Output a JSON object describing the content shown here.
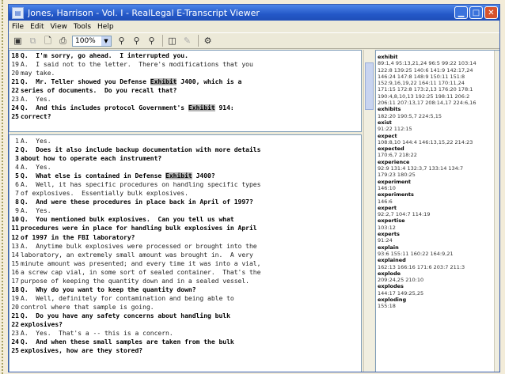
{
  "window": {
    "title": "Jones, Harrison - Vol. I - RealLegal E-Transcript Viewer"
  },
  "menu": [
    "File",
    "Edit",
    "View",
    "Tools",
    "Help"
  ],
  "toolbar": {
    "zoom": "100%"
  },
  "pane1": [
    {
      "n": "18",
      "t": "Q.  I'm sorry, go ahead.  I interrupted you.",
      "q": true
    },
    {
      "n": "19",
      "t": "A.  I said not to the letter.  There's modifications that you",
      "q": false
    },
    {
      "n": "20",
      "t": "may take.",
      "q": false
    },
    {
      "n": "21",
      "t": "Q.  Mr. Teller showed you Defense [Exhibit] J400, which is a",
      "q": true
    },
    {
      "n": "22",
      "t": "series of documents.  Do you recall that?",
      "q": true
    },
    {
      "n": "23",
      "t": "A.  Yes.",
      "q": false
    },
    {
      "n": "24",
      "t": "Q.  And this includes protocol Government's [Exhibit] 914:",
      "q": true
    },
    {
      "n": "25",
      "t": "correct?",
      "q": true
    }
  ],
  "pane2": [
    {
      "n": "1",
      "t": "A.  Yes.",
      "q": false
    },
    {
      "n": "2",
      "t": "Q.  Does it also include backup documentation with more details",
      "q": true
    },
    {
      "n": "3",
      "t": "about how to operate each instrument?",
      "q": true
    },
    {
      "n": "4",
      "t": "A.  Yes.",
      "q": false
    },
    {
      "n": "5",
      "t": "Q.  What else is contained in Defense [Exhibit] J400?",
      "q": true
    },
    {
      "n": "6",
      "t": "A.  Well, it has specific procedures on handling specific types",
      "q": false
    },
    {
      "n": "7",
      "t": "of explosives.  Essentially bulk explosives.",
      "q": false
    },
    {
      "n": "8",
      "t": "Q.  And were these procedures in place back in April of 1997?",
      "q": true
    },
    {
      "n": "9",
      "t": "A.  Yes.",
      "q": false
    },
    {
      "n": "10",
      "t": "Q.  You mentioned bulk explosives.  Can you tell us what",
      "q": true
    },
    {
      "n": "11",
      "t": "procedures were in place for handling bulk explosives in April",
      "q": true
    },
    {
      "n": "12",
      "t": "of 1997 in the FBI laboratory?",
      "q": true
    },
    {
      "n": "13",
      "t": "A.  Anytime bulk explosives were processed or brought into the",
      "q": false
    },
    {
      "n": "14",
      "t": "laboratory, an extremely small amount was brought in.  A very",
      "q": false
    },
    {
      "n": "15",
      "t": "minute amount was presented; and every time it was into a vial,",
      "q": false
    },
    {
      "n": "16",
      "t": "a screw cap vial, in some sort of sealed container.  That's the",
      "q": false
    },
    {
      "n": "17",
      "t": "purpose of keeping the quantity down and in a sealed vessel.",
      "q": false
    },
    {
      "n": "18",
      "t": "Q.  Why do you want to keep the quantity down?",
      "q": true
    },
    {
      "n": "19",
      "t": "A.  Well, definitely for contamination and being able to",
      "q": false
    },
    {
      "n": "20",
      "t": "control where that sample is going.",
      "q": false
    },
    {
      "n": "21",
      "t": "Q.  Do you have any safety concerns about handling bulk",
      "q": true
    },
    {
      "n": "22",
      "t": "explosives?",
      "q": true
    },
    {
      "n": "23",
      "t": "A.  Yes.  That's a -- this is a concern.",
      "q": false
    },
    {
      "n": "24",
      "t": "Q.  And when these small samples are taken from the bulk",
      "q": true
    },
    {
      "n": "25",
      "t": "explosives, how are they stored?",
      "q": true
    }
  ],
  "index": [
    {
      "w": "exhibit",
      "p": [
        "89:1,4 95:13,21,24 96:5 99:22 103:14",
        "122:8 139:25 140:6 141:9 142:17,24",
        "146:24 147:8 148:9 150:11 151:8",
        "152:9,16,19,22 164:11 170:11,24",
        "171:15 172:8 173:2,13 176:20 178:1",
        "190:4,8,10,13 192:25 198:11 206:2",
        "206:11 207:13,17 208:14,17 224:6,16"
      ]
    },
    {
      "w": "exhibits",
      "p": [
        "182:20 190:5,7 224:5,15"
      ]
    },
    {
      "w": "exist",
      "p": [
        "91:22 112:15"
      ]
    },
    {
      "w": "expect",
      "p": [
        "108:8,10 144:4 146:13,15,22 214:23"
      ]
    },
    {
      "w": "expected",
      "p": [
        "170:6,7 218:22"
      ]
    },
    {
      "w": "experience",
      "p": [
        "92:9 131:4 132:3,7 133:14 134:7",
        "179:23 180:25"
      ]
    },
    {
      "w": "experiment",
      "p": [
        "146:10"
      ]
    },
    {
      "w": "experiments",
      "p": [
        "146:6"
      ]
    },
    {
      "w": "expert",
      "p": [
        "92:2,7 104:7 114:19"
      ]
    },
    {
      "w": "expertise",
      "p": [
        "103:12"
      ]
    },
    {
      "w": "experts",
      "p": [
        "91:24"
      ]
    },
    {
      "w": "explain",
      "p": [
        "93:6 155:11 160:22 164:9,21"
      ]
    },
    {
      "w": "explained",
      "p": [
        "162:13 166:16 171:6 203:7 211:3"
      ]
    },
    {
      "w": "explode",
      "p": [
        "209:24,25 210:10"
      ]
    },
    {
      "w": "explodes",
      "p": [
        "144:17 149:25,25"
      ]
    },
    {
      "w": "exploding",
      "p": [
        "155:18"
      ]
    }
  ]
}
